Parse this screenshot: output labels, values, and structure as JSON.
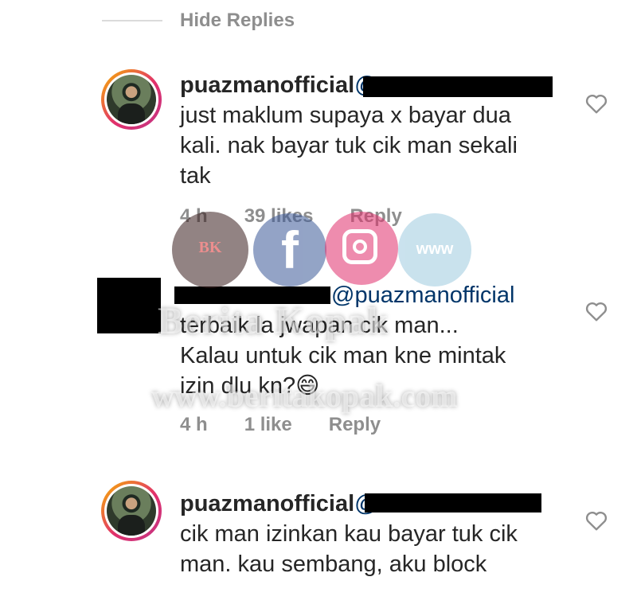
{
  "hide_replies": {
    "label": "Hide Replies"
  },
  "comments": [
    {
      "username": "puazmanofficial",
      "mention_partial": "@",
      "text_lines": [
        "just maklum supaya x bayar dua",
        "kali. nak bayar tuk cik man sekali",
        "tak"
      ],
      "time": "4 h",
      "likes": "39 likes",
      "reply": "Reply"
    },
    {
      "username": "",
      "mention": "@puazmanofficial",
      "text_lines": [
        "terbaik la jwapan cik man...",
        "Kalau untuk cik man kne mintak",
        "izin dlu kn?😄"
      ],
      "time": "4 h",
      "likes": "1 like",
      "reply": "Reply"
    },
    {
      "username": "puazmanofficial",
      "mention_partial": "@",
      "text_lines": [
        "cik man izinkan kau bayar tuk cik",
        "man. kau sembang, aku block"
      ],
      "time": "",
      "likes": "",
      "reply": ""
    }
  ],
  "watermark": {
    "badge": "BK",
    "site_name": "Berita Kopak",
    "url": "www.beritakopak.com",
    "www": "www"
  },
  "colors": {
    "text": "#262626",
    "muted": "#8e8e8e",
    "mention": "#003569",
    "facebook": "#3b5998",
    "instagram": "#e1306c"
  }
}
